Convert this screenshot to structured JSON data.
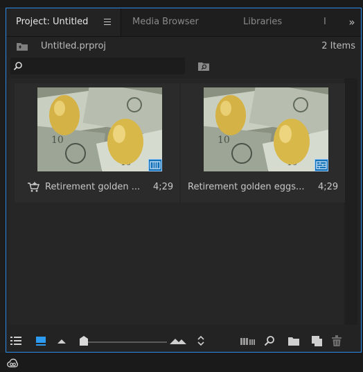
{
  "tabs": [
    {
      "label": "Project: Untitled",
      "active": true
    },
    {
      "label": "Media Browser",
      "active": false
    },
    {
      "label": "Libraries",
      "active": false
    },
    {
      "label": "I",
      "active": false
    }
  ],
  "path": {
    "name": "Untitled.prproj",
    "item_count": "2 Items"
  },
  "search": {
    "value": "",
    "placeholder": ""
  },
  "clips": [
    {
      "name": "Retirement golden ...",
      "duration": "4;29",
      "icon": "video-clip-icon",
      "has_cart_icon": true
    },
    {
      "name": "Retirement golden eggs...",
      "duration": "4;29",
      "icon": "sequence-icon",
      "has_cart_icon": false
    }
  ],
  "colors": {
    "accent": "#2d8ceb",
    "panel": "#232323",
    "icon_blue": "#1170b5"
  },
  "toolbar": {
    "icons": [
      "list-view-icon",
      "icon-view-icon",
      "small-mountain-icon",
      "zoom-slider",
      "large-mountain-icon",
      "sort-icon",
      "automate-to-sequence-icon",
      "find-icon",
      "new-bin-icon",
      "new-item-icon",
      "trash-icon"
    ],
    "zoom_level": 0.05
  },
  "status": {
    "icon": "creative-cloud-icon"
  }
}
